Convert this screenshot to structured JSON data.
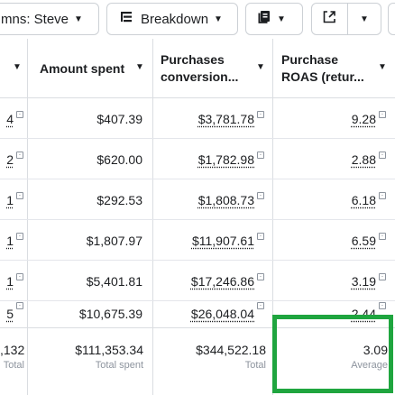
{
  "toolbar": {
    "columns_label": "mns: Steve",
    "breakdown_label": "Breakdown"
  },
  "table": {
    "headers": {
      "amount_spent": "Amount spent",
      "purchases_conv_1": "Purchases",
      "purchases_conv_2": "conversion...",
      "roas_1": "Purchase",
      "roas_2": "ROAS (retur..."
    },
    "rows": [
      {
        "left": "4",
        "amount": "$407.39",
        "conv": "$3,781.78",
        "roas": "9.28"
      },
      {
        "left": "2",
        "amount": "$620.00",
        "conv": "$1,782.98",
        "roas": "2.88"
      },
      {
        "left": "1",
        "amount": "$292.53",
        "conv": "$1,808.73",
        "roas": "6.18"
      },
      {
        "left": "1",
        "amount": "$1,807.97",
        "conv": "$11,907.61",
        "roas": "6.59"
      },
      {
        "left": "1",
        "amount": "$5,401.81",
        "conv": "$17,246.86",
        "roas": "3.19"
      },
      {
        "left": "5",
        "amount": "$10,675.39",
        "conv": "$26,048.04",
        "roas": "2.44"
      }
    ],
    "totals": {
      "left_value": ",132",
      "left_label": "Total",
      "amount_value": "$111,353.34",
      "amount_label": "Total spent",
      "conv_value": "$344,522.18",
      "conv_label": "Total",
      "roas_value": "3.09",
      "roas_label": "Average"
    }
  },
  "colors": {
    "highlight": "#1fa53f",
    "border": "#dadde1"
  }
}
